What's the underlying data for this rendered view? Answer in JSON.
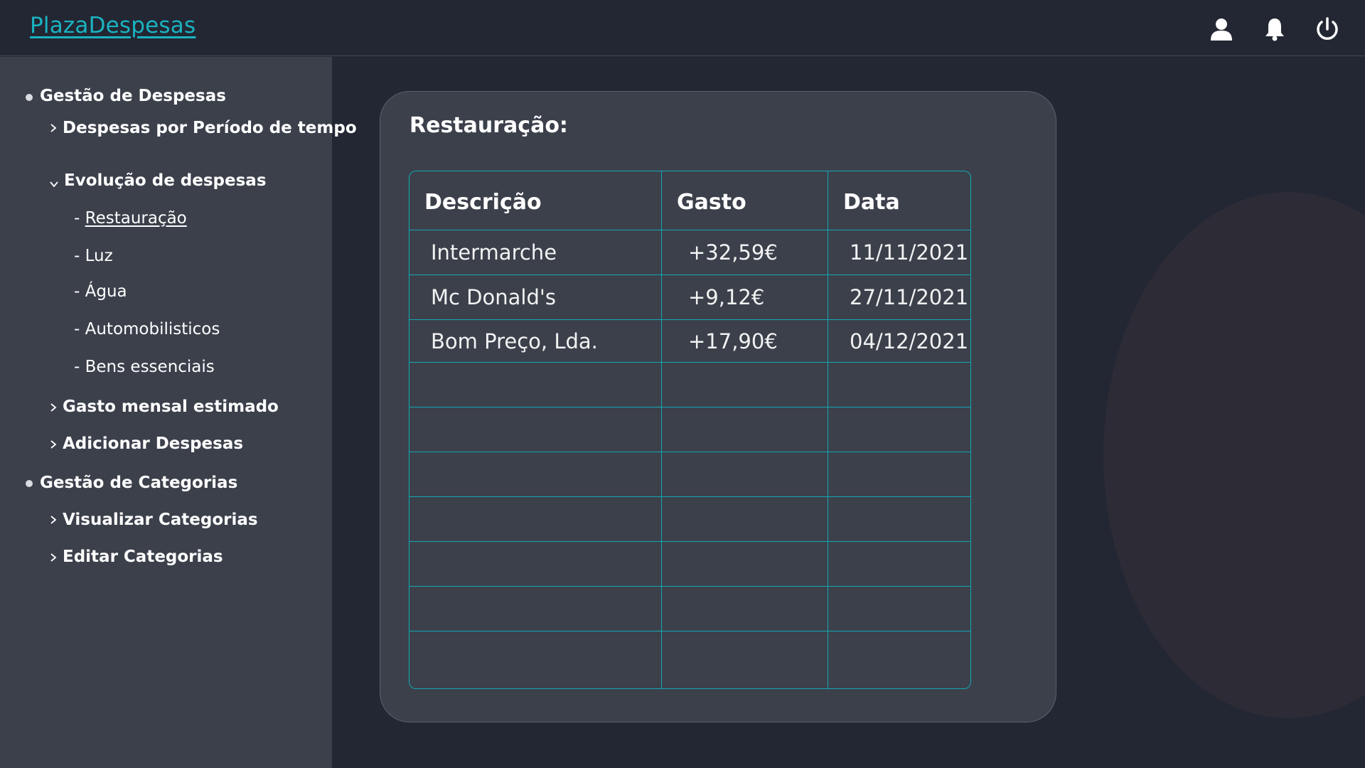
{
  "app": {
    "brand": "PlazaDespesas"
  },
  "header": {
    "icons": [
      "user-icon",
      "bell-icon",
      "power-icon"
    ]
  },
  "sidebar": {
    "sections": [
      {
        "label": "Gestão de Despesas",
        "items": [
          {
            "label": "Despesas por Período de tempo",
            "expanded": false
          },
          {
            "label": "Evolução de despesas",
            "expanded": true,
            "children": [
              "Restauração",
              "Luz",
              "Água",
              "Automobilisticos",
              "Bens essenciais"
            ],
            "active_child": "Restauração"
          },
          {
            "label": "Gasto mensal estimado",
            "expanded": false
          },
          {
            "label": "Adicionar Despesas",
            "expanded": false
          }
        ]
      },
      {
        "label": "Gestão de Categorias",
        "items": [
          {
            "label": "Visualizar Categorias",
            "expanded": false
          },
          {
            "label": "Editar Categorias",
            "expanded": false
          }
        ]
      }
    ],
    "leaf_prefix": "- "
  },
  "main": {
    "card_title": "Restauração:",
    "table": {
      "headers": [
        "Descrição",
        "Gasto",
        "Data"
      ],
      "rows": [
        [
          "Intermarche",
          "+32,59€",
          "11/11/2021"
        ],
        [
          "Mc Donald's",
          "+9,12€",
          "27/11/2021"
        ],
        [
          "Bom Preço, Lda.",
          "+17,90€",
          "04/12/2021"
        ]
      ],
      "empty_rows": 7
    }
  },
  "colors": {
    "accent": "#1ab3c0",
    "table_border": "#14a8b4",
    "sidebar_bg": "#3b404b",
    "page_bg": "#222733"
  }
}
